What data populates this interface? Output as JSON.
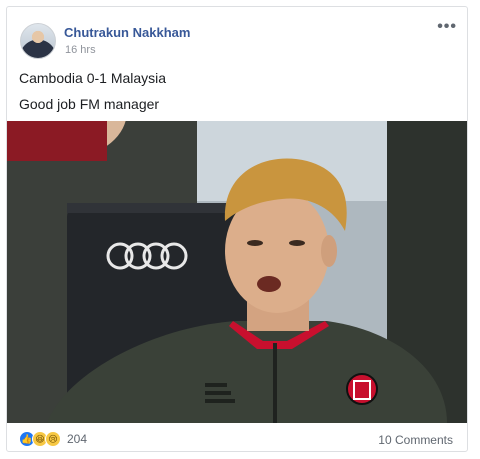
{
  "post": {
    "author": "Chutrakun Nakkham",
    "time": "16 hrs",
    "more_label": "•••",
    "lines": [
      "Cambodia 0-1 Malaysia",
      "Good job FM manager"
    ]
  },
  "photo": {
    "semantic": "football-player-on-bench-photo",
    "jersey_color": "#3a4138",
    "accent_color": "#c8102e"
  },
  "footer": {
    "reaction_icons": [
      "like-icon",
      "haha-icon",
      "sad-icon"
    ],
    "reaction_glyphs": [
      "👍",
      "😆",
      "😢"
    ],
    "reaction_count": "204",
    "comments_label": "10 Comments"
  },
  "colors": {
    "author_link": "#385898",
    "secondary_text": "#90949c",
    "like_blue": "#2078f4"
  }
}
